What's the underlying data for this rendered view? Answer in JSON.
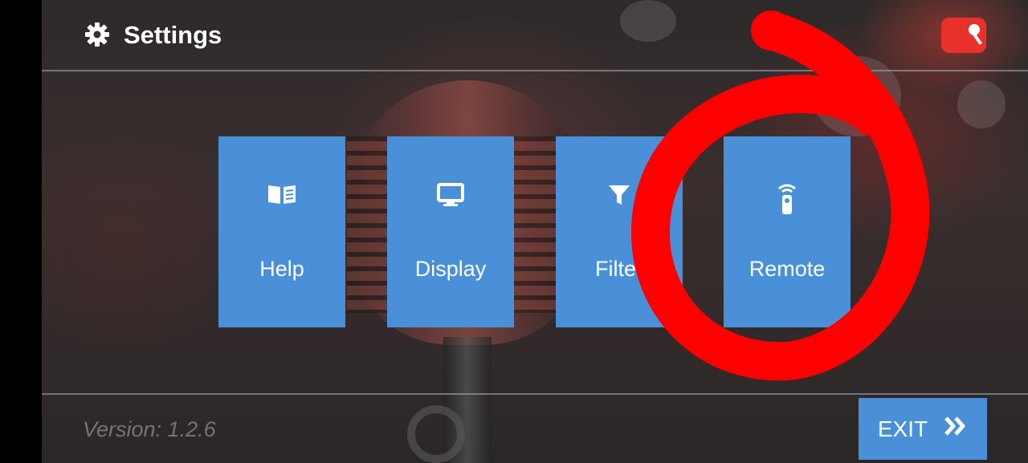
{
  "header": {
    "title": "Settings",
    "title_icon": "gear-icon",
    "app_logo": "karaoke-app-logo"
  },
  "tiles": [
    {
      "label": "Help",
      "icon": "book-icon"
    },
    {
      "label": "Display",
      "icon": "monitor-icon"
    },
    {
      "label": "Filter",
      "icon": "filter-icon"
    },
    {
      "label": "Remote",
      "icon": "remote-icon"
    }
  ],
  "footer": {
    "version": "Version: 1.2.6",
    "exit_label": "EXIT",
    "exit_icon": "double-chevron-right-icon"
  },
  "colors": {
    "tile_blue": "#4a90d9",
    "annotation_red": "#ff0000",
    "logo_red": "#e8312a"
  }
}
